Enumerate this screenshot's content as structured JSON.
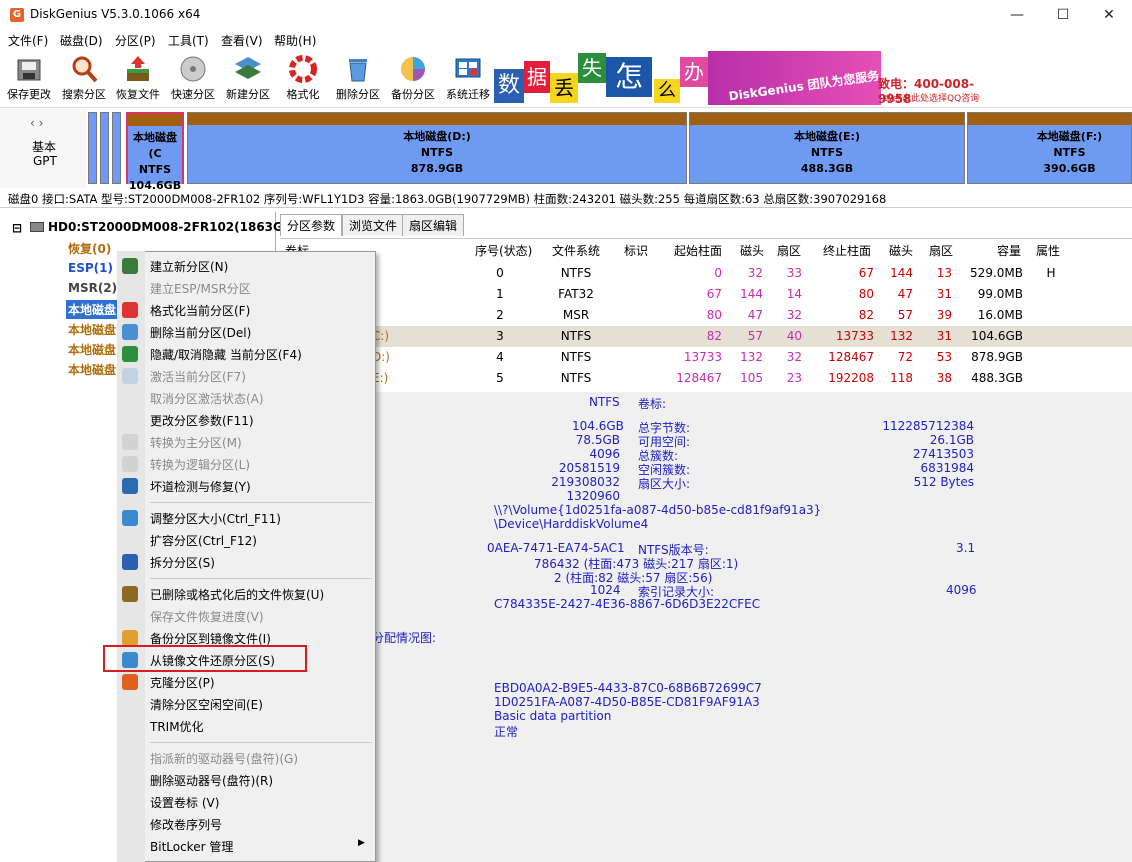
{
  "window": {
    "title": "DiskGenius V5.3.0.1066 x64",
    "icon": "G"
  },
  "menu": [
    "文件(F)",
    "磁盘(D)",
    "分区(P)",
    "工具(T)",
    "查看(V)",
    "帮助(H)"
  ],
  "toolbar": [
    {
      "label": "保存更改",
      "icon": "save-icon"
    },
    {
      "label": "搜索分区",
      "icon": "search-icon"
    },
    {
      "label": "恢复文件",
      "icon": "recover-icon"
    },
    {
      "label": "快速分区",
      "icon": "quick-partition-icon"
    },
    {
      "label": "新建分区",
      "icon": "new-partition-icon"
    },
    {
      "label": "格式化",
      "icon": "format-icon"
    },
    {
      "label": "删除分区",
      "icon": "delete-icon"
    },
    {
      "label": "备份分区",
      "icon": "backup-icon"
    },
    {
      "label": "系统迁移",
      "icon": "migrate-icon"
    }
  ],
  "banner": {
    "chars": [
      "数",
      "据",
      "丢",
      "失",
      "怎",
      "么",
      "办"
    ],
    "brand": "DiskGenius 团队为您服务",
    "phone": "致电：400-008-9958",
    "qq": "或点击此处选择QQ咨询"
  },
  "disk_nav": {
    "line1": "基本",
    "line2": "GPT"
  },
  "partitions": [
    {
      "name": "本地磁盘(C",
      "fs": "NTFS",
      "size": "104.6GB"
    },
    {
      "name": "本地磁盘(D:)",
      "fs": "NTFS",
      "size": "878.9GB"
    },
    {
      "name": "本地磁盘(E:)",
      "fs": "NTFS",
      "size": "488.3GB"
    },
    {
      "name": "本地磁盘(F:)",
      "fs": "NTFS",
      "size": "390.6GB"
    }
  ],
  "disk_info": "磁盘0 接口:SATA  型号:ST2000DM008-2FR102  序列号:WFL1Y1D3  容量:1863.0GB(1907729MB)  柱面数:243201  磁头数:255  每道扇区数:63  总扇区数:3907029168",
  "tree": {
    "root": "HD0:ST2000DM008-2FR102(1863GB)",
    "items": [
      "恢复(0)",
      "ESP(1)",
      "MSR(2)",
      "本地磁盘",
      "本地磁盘",
      "本地磁盘",
      "本地磁盘"
    ]
  },
  "tabs": [
    "分区参数",
    "浏览文件",
    "扇区编辑"
  ],
  "table": {
    "headers": [
      "卷标",
      "序号(状态)",
      "文件系统",
      "标识",
      "起始柱面",
      "磁头",
      "扇区",
      "终止柱面",
      "磁头",
      "扇区",
      "容量",
      "属性"
    ],
    "rows": [
      {
        "label": "",
        "idx": "0",
        "fs": "NTFS",
        "id": "",
        "sc": "0",
        "sh": "32",
        "ss": "33",
        "ec": "67",
        "eh": "144",
        "es": "13",
        "cap": "529.0MB",
        "attr": "H"
      },
      {
        "label": "",
        "idx": "1",
        "fs": "FAT32",
        "id": "",
        "sc": "67",
        "sh": "144",
        "ss": "14",
        "ec": "80",
        "eh": "47",
        "es": "31",
        "cap": "99.0MB",
        "attr": ""
      },
      {
        "label": "",
        "idx": "2",
        "fs": "MSR",
        "id": "",
        "sc": "80",
        "sh": "47",
        "ss": "32",
        "ec": "82",
        "eh": "57",
        "es": "39",
        "cap": "16.0MB",
        "attr": ""
      },
      {
        "label": "C:)",
        "idx": "3",
        "fs": "NTFS",
        "id": "",
        "sc": "82",
        "sh": "57",
        "ss": "40",
        "ec": "13733",
        "eh": "132",
        "es": "31",
        "cap": "104.6GB",
        "attr": ""
      },
      {
        "label": "D:)",
        "idx": "4",
        "fs": "NTFS",
        "id": "",
        "sc": "13733",
        "sh": "132",
        "ss": "32",
        "ec": "128467",
        "eh": "72",
        "es": "53",
        "cap": "878.9GB",
        "attr": ""
      },
      {
        "label": "E:)",
        "idx": "5",
        "fs": "NTFS",
        "id": "",
        "sc": "128467",
        "sh": "105",
        "ss": "23",
        "ec": "192208",
        "eh": "118",
        "es": "38",
        "cap": "488.3GB",
        "attr": ""
      }
    ]
  },
  "detail": {
    "fs": "NTFS",
    "vol_label": "卷标:",
    "left_vals": [
      "104.6GB",
      "78.5GB",
      "4096",
      "20581519",
      "219308032",
      "1320960"
    ],
    "right_labels": [
      "总字节数:",
      "可用空间:",
      "总簇数:",
      "空闲簇数:",
      "扇区大小:"
    ],
    "right_vals": [
      "112285712384",
      "26.1GB",
      "27413503",
      "6831984",
      "512 Bytes"
    ],
    "volume_paths": [
      "\\\\?\\Volume{1d0251fa-a087-4d50-b85e-cd81f9af91a3}",
      "\\Device\\HarddiskVolume4"
    ],
    "serial": "0AEA-7471-EA74-5AC1",
    "ntfs_ver_label": "NTFS版本号:",
    "ntfs_ver": "3.1",
    "mft1": "786432 (柱面:473 磁头:217 扇区:1)",
    "mft2": "2 (柱面:82 磁头:57 扇区:56)",
    "index_val": "1024",
    "index_label": "索引记录大小:",
    "index_size": "4096",
    "guid_small": "C784335E-2427-4E36-8867-6D6D3E22CFEC",
    "alloc_label": "分配情况图:",
    "guid1": "EBD0A0A2-B9E5-4433-87C0-68B6B72699C7",
    "guid2": "1D0251FA-A087-4D50-B85E-CD81F9AF91A3",
    "ptype": "Basic data partition",
    "pstatus": "正常"
  },
  "context_menu": [
    {
      "label": "建立新分区(N)",
      "enabled": true,
      "icon": "new-partition-icon"
    },
    {
      "label": "建立ESP/MSR分区",
      "enabled": false,
      "icon": ""
    },
    {
      "label": "格式化当前分区(F)",
      "enabled": true,
      "icon": "format-icon"
    },
    {
      "label": "删除当前分区(Del)",
      "enabled": true,
      "icon": "delete-icon"
    },
    {
      "label": "隐藏/取消隐藏 当前分区(F4)",
      "enabled": true,
      "icon": "hide-icon"
    },
    {
      "label": "激活当前分区(F7)",
      "enabled": false,
      "icon": "activate-icon"
    },
    {
      "label": "取消分区激活状态(A)",
      "enabled": false,
      "icon": ""
    },
    {
      "label": "更改分区参数(F11)",
      "enabled": true,
      "icon": ""
    },
    {
      "label": "转换为主分区(M)",
      "enabled": false,
      "icon": "primary-icon"
    },
    {
      "label": "转换为逻辑分区(L)",
      "enabled": false,
      "icon": "logical-icon"
    },
    {
      "label": "坏道检测与修复(Y)",
      "enabled": true,
      "icon": "tools-icon"
    },
    {
      "label": "调整分区大小(Ctrl_F11)",
      "enabled": true,
      "icon": "resize-icon"
    },
    {
      "label": "扩容分区(Ctrl_F12)",
      "enabled": true,
      "icon": ""
    },
    {
      "label": "拆分分区(S)",
      "enabled": true,
      "icon": "split-icon"
    },
    {
      "label": "已删除或格式化后的文件恢复(U)",
      "enabled": true,
      "icon": "recover-icon"
    },
    {
      "label": "保存文件恢复进度(V)",
      "enabled": false,
      "icon": ""
    },
    {
      "label": "备份分区到镜像文件(I)",
      "enabled": true,
      "icon": "backup-icon"
    },
    {
      "label": "从镜像文件还原分区(S)",
      "enabled": true,
      "icon": "restore-icon"
    },
    {
      "label": "克隆分区(P)",
      "enabled": true,
      "icon": "clone-icon"
    },
    {
      "label": "清除分区空闲空间(E)",
      "enabled": true,
      "icon": ""
    },
    {
      "label": "TRIM优化",
      "enabled": true,
      "icon": ""
    },
    {
      "label": "指派新的驱动器号(盘符)(G)",
      "enabled": false,
      "icon": ""
    },
    {
      "label": "删除驱动器号(盘符)(R)",
      "enabled": true,
      "icon": ""
    },
    {
      "label": "设置卷标 (V)",
      "enabled": true,
      "icon": ""
    },
    {
      "label": "修改卷序列号",
      "enabled": true,
      "icon": ""
    },
    {
      "label": "BitLocker 管理",
      "enabled": true,
      "icon": ""
    }
  ]
}
